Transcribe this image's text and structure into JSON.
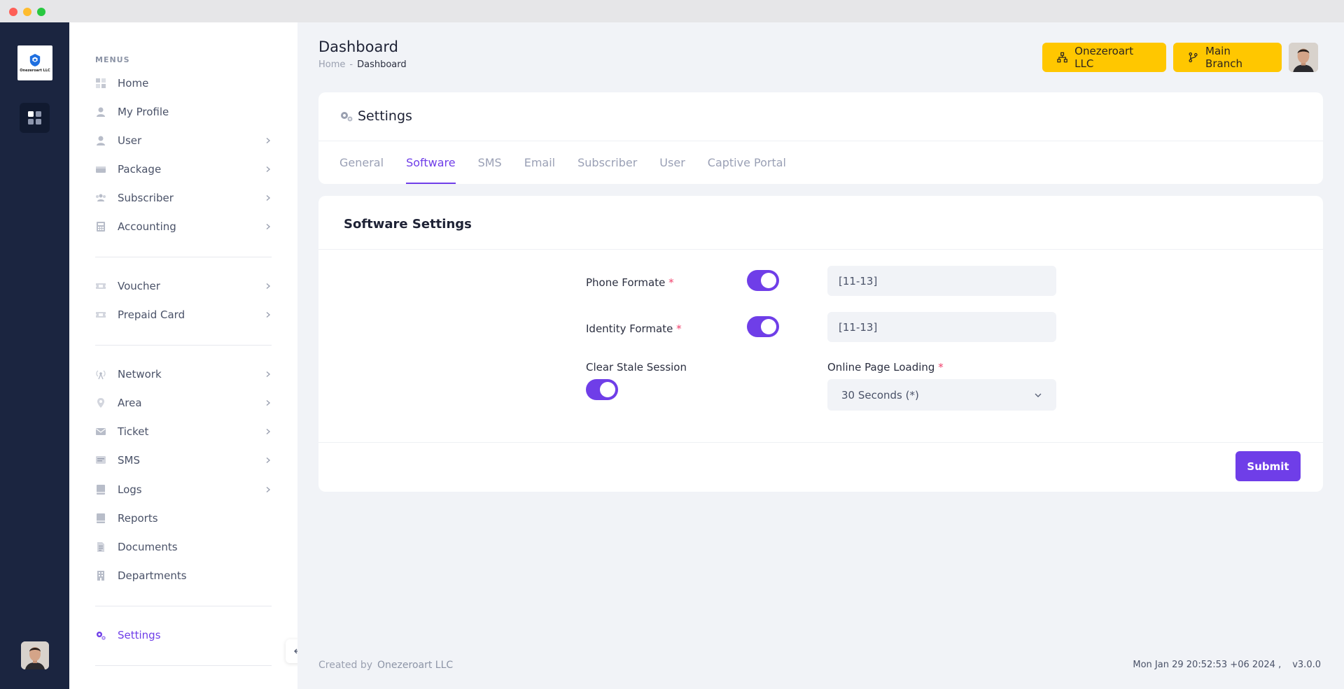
{
  "sidebar": {
    "logo_text": "Onezeroart LLC",
    "menus_heading": "MENUS",
    "items": [
      {
        "label": "Home",
        "icon": "grid-icon"
      },
      {
        "label": "My Profile",
        "icon": "person-icon"
      },
      {
        "label": "User",
        "icon": "person-icon"
      },
      {
        "label": "Package",
        "icon": "package-icon"
      },
      {
        "label": "Subscriber",
        "icon": "people-icon"
      },
      {
        "label": "Accounting",
        "icon": "calculator-icon"
      },
      {
        "label": "Voucher",
        "icon": "ticket-icon"
      },
      {
        "label": "Prepaid Card",
        "icon": "ticket-icon"
      },
      {
        "label": "Network",
        "icon": "broadcast-icon"
      },
      {
        "label": "Area",
        "icon": "location-icon"
      },
      {
        "label": "Ticket",
        "icon": "envelope-icon"
      },
      {
        "label": "SMS",
        "icon": "message-icon"
      },
      {
        "label": "Logs",
        "icon": "book-icon"
      },
      {
        "label": "Reports",
        "icon": "book-icon"
      },
      {
        "label": "Documents",
        "icon": "document-icon"
      },
      {
        "label": "Departments",
        "icon": "building-icon"
      },
      {
        "label": "Settings",
        "icon": "gears-icon"
      }
    ]
  },
  "header": {
    "title": "Dashboard",
    "breadcrumb": {
      "home": "Home",
      "separator": "-",
      "current": "Dashboard"
    },
    "company_button": "Onezeroart LLC",
    "branch_button": "Main Branch"
  },
  "settings": {
    "title": "Settings",
    "tabs": [
      "General",
      "Software",
      "SMS",
      "Email",
      "Subscriber",
      "User",
      "Captive Portal"
    ],
    "active_tab": "Software"
  },
  "form": {
    "title": "Software Settings",
    "phone_label": "Phone Formate",
    "phone_value": "[11-13]",
    "identity_label": "Identity Formate",
    "identity_value": "[11-13]",
    "clear_session_label": "Clear Stale Session",
    "online_loading_label": "Online Page Loading",
    "online_loading_value": "30 Seconds (*)",
    "required_mark": "*",
    "submit_label": "Submit"
  },
  "footer": {
    "created_by": "Created by",
    "company": "Onezeroart LLC",
    "datetime": "Mon Jan 29 20:52:53 +06 2024 ,",
    "version": "v3.0.0"
  },
  "colors": {
    "accent": "#6f3ee8",
    "yellow": "#ffc700",
    "rail": "#1b2540",
    "required": "#f1416c"
  }
}
